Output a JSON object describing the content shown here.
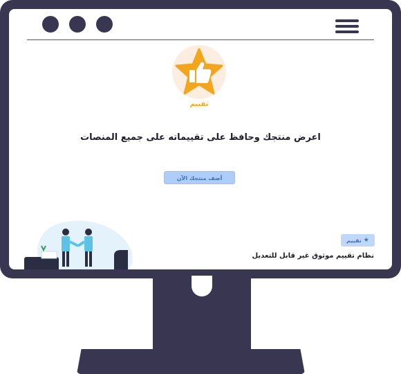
{
  "logo": {
    "caption": "تقييم",
    "icon": "thumbs-up-star-icon"
  },
  "headline": "اعرض منتجك وحافظ على تقييماته على جميع المنصات",
  "cta": {
    "label": "أضف منتجك الآن"
  },
  "badge": {
    "label": "تقييم",
    "icon": "star-icon"
  },
  "tagline": "نظام تقييم موثوق غير قابل للتعديل",
  "colors": {
    "frame": "#383650",
    "accent_orange": "#f3a51d",
    "button_blue": "#aecdf8",
    "text_dark": "#1e1e2a"
  }
}
